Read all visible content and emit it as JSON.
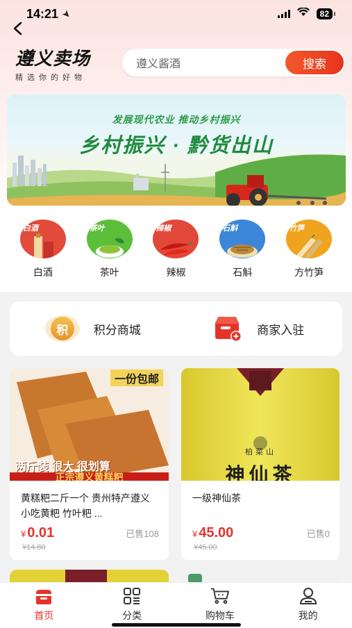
{
  "status": {
    "time": "14:21",
    "battery": "82"
  },
  "header": {
    "logo_title": "遵义卖场",
    "logo_sub": "精选你的好物"
  },
  "search": {
    "value": "遵义酱酒",
    "button": "搜索"
  },
  "banner": {
    "subtitle": "发展现代农业 推动乡村振兴",
    "title": "乡村振兴 · 黔货出山"
  },
  "categories": [
    {
      "tag": "白酒",
      "label": "白酒",
      "icon": "baijiu-icon"
    },
    {
      "tag": "茶叶",
      "label": "茶叶",
      "icon": "tea-icon"
    },
    {
      "tag": "辣椒",
      "label": "辣椒",
      "icon": "chili-icon"
    },
    {
      "tag": "石斛",
      "label": "石斛",
      "icon": "dendrobium-icon"
    },
    {
      "tag": "竹笋",
      "label": "方竹笋",
      "icon": "bamboo-shoot-icon"
    }
  ],
  "promo": {
    "points_label": "积分商城",
    "points_badge": "积",
    "merchant_label": "商家入驻"
  },
  "products": [
    {
      "name": "黄糕粑二斤一个 贵州特产遵义小吃黄粑 竹叶粑 ...",
      "price_symbol": "¥",
      "price": "0.01",
      "sold": "已售108",
      "original_price": "¥14.80",
      "img_banner_top": "一份包邮",
      "img_banner_mid": "两斤装 很大 很划算",
      "img_banner_bottom": "正宗遵义黄糕粑"
    },
    {
      "name": "一级神仙茶",
      "price_symbol": "¥",
      "price": "45.00",
      "sold": "已售0",
      "original_price": "¥45.00",
      "img_brand": "柏菜山",
      "img_title": "神仙茶"
    }
  ],
  "tabs": [
    {
      "label": "首页",
      "icon": "home-icon",
      "active": true
    },
    {
      "label": "分类",
      "icon": "category-icon",
      "active": false
    },
    {
      "label": "购物车",
      "icon": "cart-icon",
      "active": false
    },
    {
      "label": "我的",
      "icon": "profile-icon",
      "active": false
    }
  ],
  "colors": {
    "accent": "#e6332a",
    "search_button": "#ef4a26",
    "banner_green": "#1f8a3c"
  }
}
